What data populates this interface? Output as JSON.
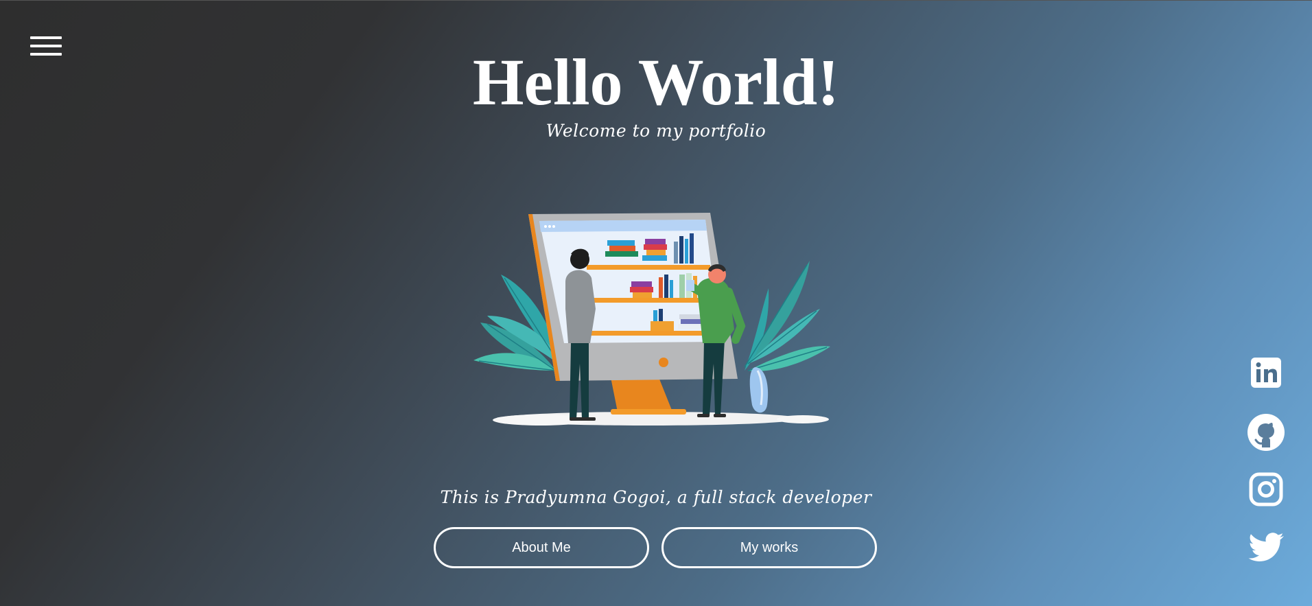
{
  "colors": {
    "foreground": "#ffffff",
    "gradient_start": "#2e2e2e",
    "gradient_end": "#6cabdb"
  },
  "nav": {
    "menu_icon": "hamburger-menu-icon"
  },
  "hero": {
    "title": "Hello World!",
    "subtitle": "Welcome to my portfolio",
    "illustration": "people-browsing-bookshelf-on-monitor-illustration",
    "tagline": "This is Pradyumna Gogoi, a full stack developer"
  },
  "buttons": {
    "about": "About Me",
    "works": "My works"
  },
  "social": [
    {
      "name": "linkedin",
      "icon": "linkedin-icon"
    },
    {
      "name": "github",
      "icon": "github-icon"
    },
    {
      "name": "instagram",
      "icon": "instagram-icon"
    },
    {
      "name": "twitter",
      "icon": "twitter-icon"
    }
  ]
}
